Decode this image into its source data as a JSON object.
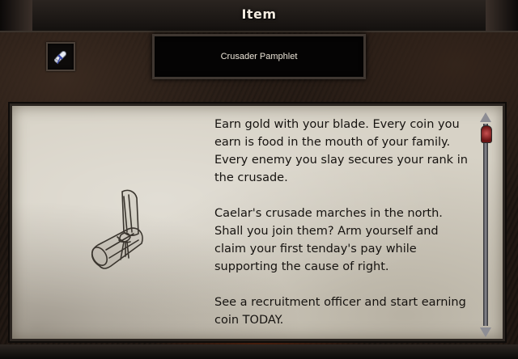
{
  "window": {
    "title": "Item"
  },
  "item": {
    "icon": "rolled-scroll-icon",
    "name": "Crusader Pamphlet",
    "picture": "rolled-parchment-scroll-illustration",
    "description": [
      "Earn gold with your blade. Every coin you earn is food in the mouth of your family. Every enemy you slay secures your rank in the crusade.",
      "Caelar's crusade marches in the north. Shall you join them? Arm yourself and claim your first tenday's pay while supporting the cause of right.",
      "See a recruitment officer and start earning coin TODAY."
    ]
  },
  "scrollbar": {
    "thumb_color": "#b03a3a"
  }
}
